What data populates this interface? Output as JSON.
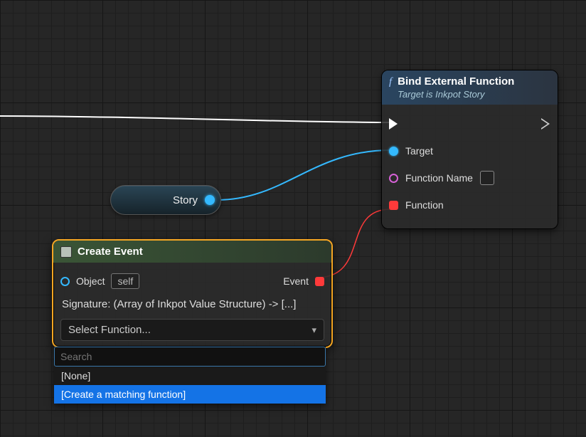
{
  "story_var": {
    "label": "Story"
  },
  "bind_node": {
    "title": "Bind External Function",
    "subtitle": "Target is Inkpot Story",
    "icon_glyph": "f",
    "pins": {
      "target": "Target",
      "function_name": "Function Name",
      "function": "Function"
    }
  },
  "create_node": {
    "title": "Create Event",
    "object_label": "Object",
    "object_value": "self",
    "event_label": "Event",
    "signature": "Signature: (Array of Inkpot Value Structure) -> [...]",
    "select_placeholder": "Select Function..."
  },
  "dropdown": {
    "search_placeholder": "Search",
    "options": [
      "[None]",
      "[Create a matching function]"
    ],
    "selected_index": 1
  }
}
